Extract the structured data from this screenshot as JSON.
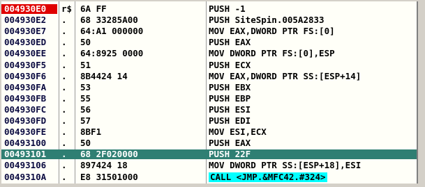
{
  "disassembly": {
    "rows": [
      {
        "address": "004930E0",
        "marker": "r$",
        "hex": "6A FF",
        "instruction": "PUSH -1"
      },
      {
        "address": "004930E2",
        "marker": ".",
        "hex": "68 33285A00",
        "instruction": "PUSH SiteSpin.005A2833"
      },
      {
        "address": "004930E7",
        "marker": ".",
        "hex": "64:A1 000000",
        "instruction": "MOV EAX,DWORD PTR FS:[0]"
      },
      {
        "address": "004930ED",
        "marker": ".",
        "hex": "50",
        "instruction": "PUSH EAX"
      },
      {
        "address": "004930EE",
        "marker": ".",
        "hex": "64:8925 0000",
        "instruction": "MOV DWORD PTR FS:[0],ESP"
      },
      {
        "address": "004930F5",
        "marker": ".",
        "hex": "51",
        "instruction": "PUSH ECX"
      },
      {
        "address": "004930F6",
        "marker": ".",
        "hex": "8B4424 14",
        "instruction": "MOV EAX,DWORD PTR SS:[ESP+14]"
      },
      {
        "address": "004930FA",
        "marker": ".",
        "hex": "53",
        "instruction": "PUSH EBX"
      },
      {
        "address": "004930FB",
        "marker": ".",
        "hex": "55",
        "instruction": "PUSH EBP"
      },
      {
        "address": "004930FC",
        "marker": ".",
        "hex": "56",
        "instruction": "PUSH ESI"
      },
      {
        "address": "004930FD",
        "marker": ".",
        "hex": "57",
        "instruction": "PUSH EDI"
      },
      {
        "address": "004930FE",
        "marker": ".",
        "hex": "8BF1",
        "instruction": "MOV ESI,ECX"
      },
      {
        "address": "00493100",
        "marker": ".",
        "hex": "50",
        "instruction": "PUSH EAX"
      },
      {
        "address": "00493101",
        "marker": ".",
        "hex": "68 2F020000",
        "instruction": "PUSH 22F"
      },
      {
        "address": "00493106",
        "marker": ".",
        "hex": "897424 18",
        "instruction": "MOV DWORD PTR SS:[ESP+18],ESI"
      },
      {
        "address": "0049310A",
        "marker": ".",
        "hex": "E8 31501000",
        "instruction": "CALL <JMP.&MFC42.#324>"
      }
    ],
    "current_row": 0,
    "selected_row": 13,
    "call_row": 15
  },
  "colors": {
    "current_address_bg": "#e00000",
    "selection_bg": "#2f7f73",
    "call_highlight_bg": "#00ffff"
  }
}
